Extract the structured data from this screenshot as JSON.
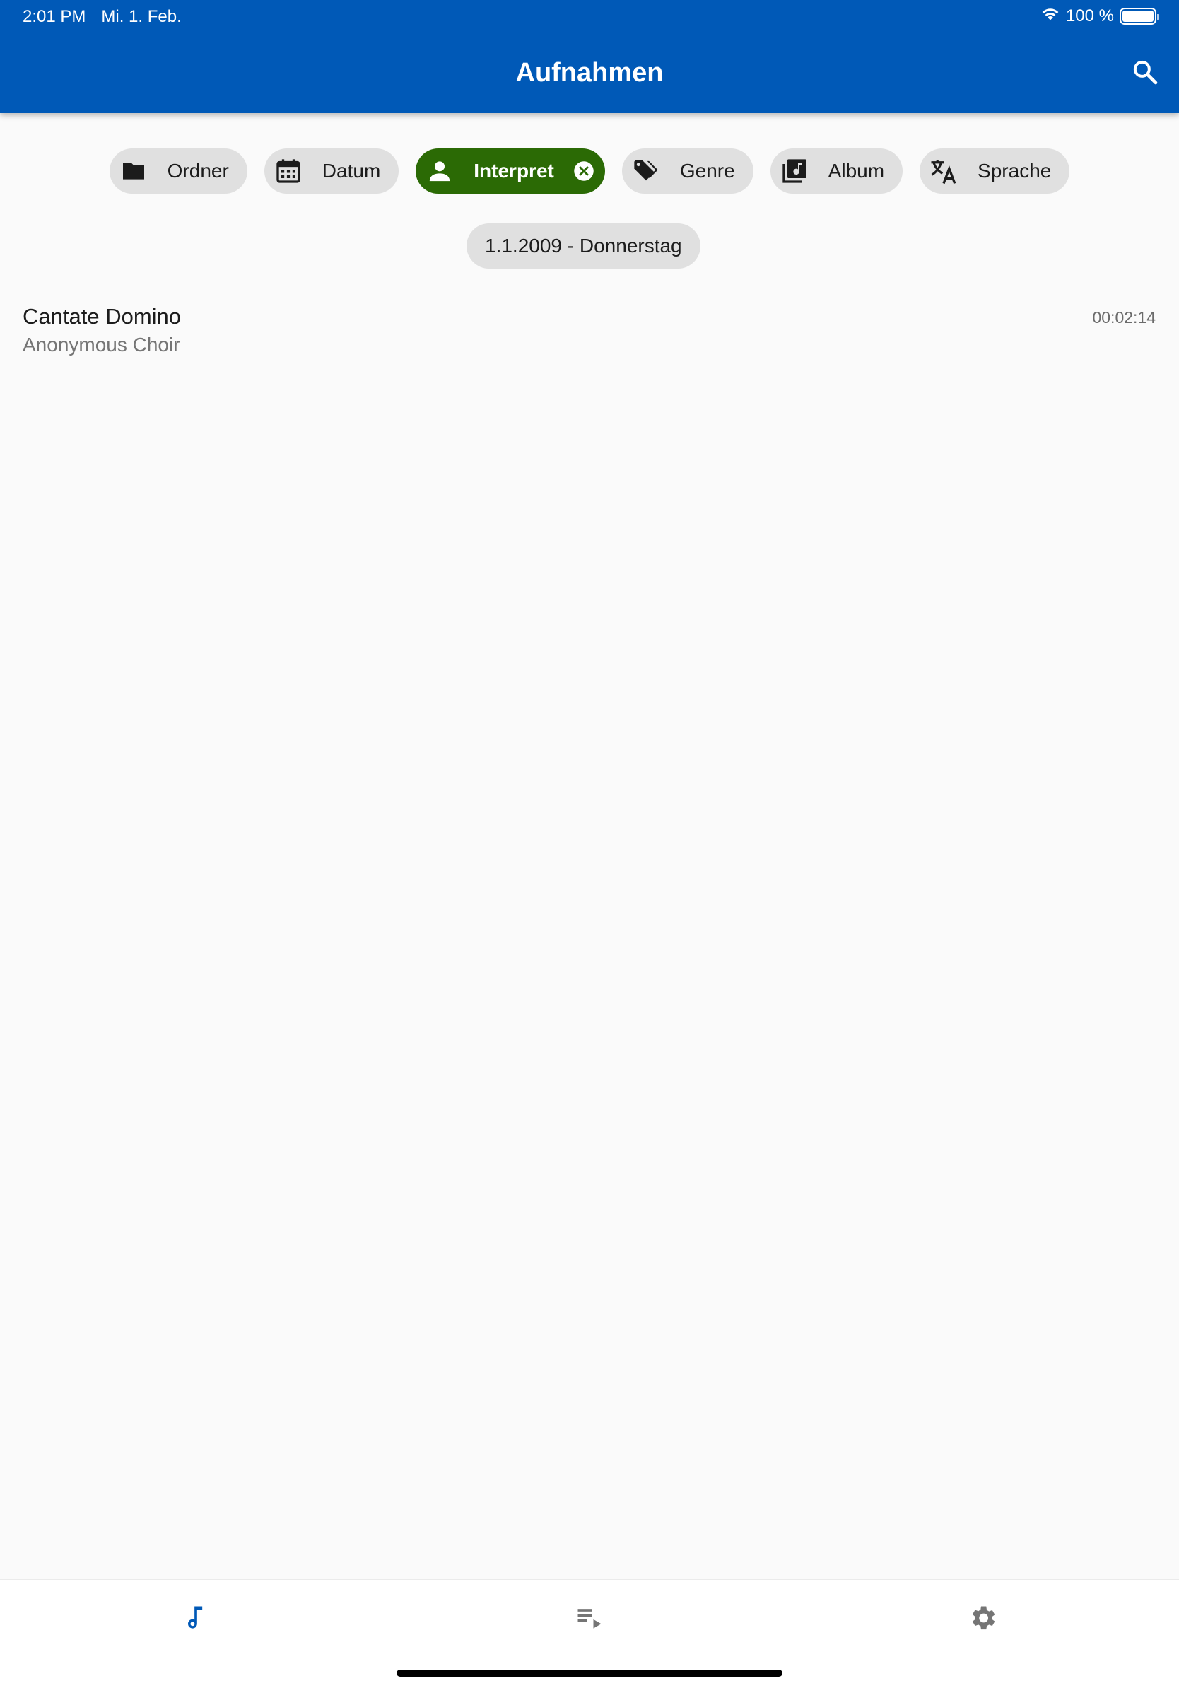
{
  "status_bar": {
    "time": "2:01 PM",
    "date": "Mi. 1. Feb.",
    "battery": "100 %",
    "battery_level": 1.0
  },
  "header": {
    "title": "Aufnahmen",
    "search_icon": "search-icon",
    "background_color": "#0059b7"
  },
  "filters": {
    "chips": [
      {
        "label": "Ordner",
        "icon": "folder-icon",
        "selected": false
      },
      {
        "label": "Datum",
        "icon": "calendar-icon",
        "selected": false
      },
      {
        "label": "Interpret",
        "icon": "person-icon",
        "selected": true,
        "close_icon": "close-circle-icon"
      },
      {
        "label": "Genre",
        "icon": "tag-icon",
        "selected": false
      },
      {
        "label": "Album",
        "icon": "album-icon",
        "selected": false
      },
      {
        "label": "Sprache",
        "icon": "translate-icon",
        "selected": false
      }
    ],
    "selected_color": "#2b6a05",
    "chip_color": "#e0e0e0"
  },
  "group": {
    "label": "1.1.2009 - Donnerstag"
  },
  "recordings": [
    {
      "title": "Cantate Domino",
      "artist": "Anonymous Choir",
      "duration": "00:02:14"
    }
  ],
  "bottom_nav": {
    "items": [
      {
        "icon": "music-note-icon",
        "active": true
      },
      {
        "icon": "playlist-play-icon",
        "active": false
      },
      {
        "icon": "settings-icon",
        "active": false
      }
    ],
    "active_color": "#0059b7",
    "inactive_color": "#757575"
  }
}
